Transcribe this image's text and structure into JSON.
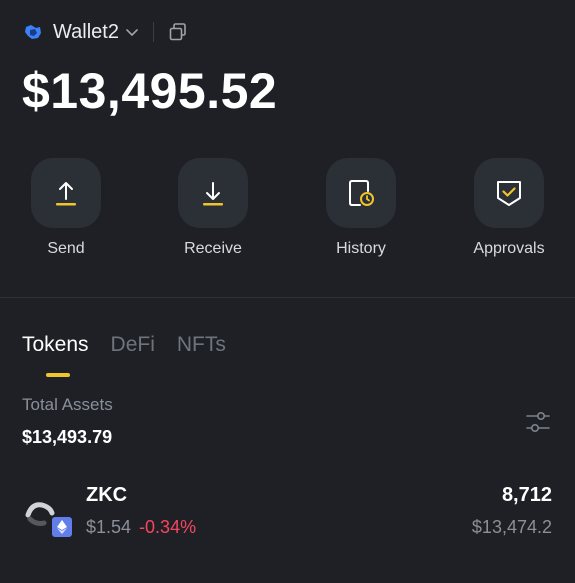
{
  "header": {
    "wallet_name": "Wallet2",
    "logo_icon": "wallet-logo-icon",
    "chevron_icon": "chevron-down-icon",
    "copy_icon": "copy-icon"
  },
  "balance": {
    "total": "$13,495.52"
  },
  "actions": [
    {
      "label": "Send",
      "icon": "send-icon"
    },
    {
      "label": "Receive",
      "icon": "receive-icon"
    },
    {
      "label": "History",
      "icon": "history-icon"
    },
    {
      "label": "Approvals",
      "icon": "approvals-icon"
    }
  ],
  "tabs": [
    {
      "label": "Tokens",
      "active": true
    },
    {
      "label": "DeFi",
      "active": false
    },
    {
      "label": "NFTs",
      "active": false
    }
  ],
  "assets": {
    "label": "Total Assets",
    "value": "$13,493.79",
    "filter_icon": "filter-sliders-icon"
  },
  "tokens": [
    {
      "symbol": "ZKC",
      "price": "$1.54",
      "change": "-0.34%",
      "amount": "8,712",
      "value": "$13,474.2",
      "chain_icon": "ethereum-icon"
    }
  ],
  "colors": {
    "background": "#1e2026",
    "button_bg": "#2b2f36",
    "accent": "#f0c52c",
    "negative": "#f6465d",
    "muted": "#8a8f98"
  }
}
